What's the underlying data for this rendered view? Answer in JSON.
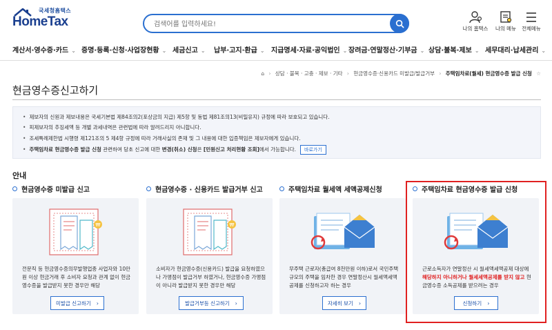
{
  "header": {
    "logo_small": "국세청홈택스",
    "logo_main": "HomeTax",
    "search_placeholder": "검색어를 입력하세요!",
    "icons": [
      {
        "label": "나의 홈택스",
        "icon": "person-icon"
      },
      {
        "label": "나의 메뉴",
        "icon": "my-menu-icon"
      },
      {
        "label": "전체메뉴",
        "icon": "hamburger-icon"
      }
    ]
  },
  "nav": [
    "계산서·영수증·카드",
    "증명·등록·신청·사업장현황",
    "세금신고",
    "납부·고지·환급",
    "지급명세·자료·공익법인",
    "장려금·연말정산·기부금",
    "상담·불복·제보",
    "세무대리·납세관리"
  ],
  "breadcrumb": {
    "items": [
      "상담 · 불복 · 고충 · 제보 · 기타",
      "현금영수증·신용카드 미발급/발급거부"
    ],
    "current": "주택임차료(월세) 현금영수증 발급 신청"
  },
  "page_title": "현금영수증신고하기",
  "notice": {
    "lines": [
      "제보자의 신원과 제보내용은 국세기본법 제84조의2(포상금의 지급) 제5항 및 동법 제81조의13(비밀유지) 규정에 따라 보호되고 있습니다.",
      "피제보자의 추징세액 등 개별 과세내역은 관련법에 따라 알려드리지 아니합니다.",
      "조세특례제한법 시행령 제121조의 5 제4항 규정에 따라 거래사실의 존재 및 그 내용에 대한 입증책임은 제보자에게 있습니다."
    ],
    "last_line": {
      "bold1": "주택임차료 현금영수증 발급 신청",
      "text1": " 관련하여 당초 신고에 대한 ",
      "bold2": "변경(취소) 신청",
      "text2": "은 ",
      "bold3": "[민원신고 처리현황 조회]",
      "text3": "에서 가능합니다.",
      "button": "바로가기"
    }
  },
  "guide_title": "안내",
  "cards": [
    {
      "title": "현금영수증 미발급 신고",
      "desc": "전문직 등 현금영수증의무발행업종 사업자와 10만원 이상 현금거래 후 소비자 요청과 관계 없이 현금영수증을 발급받지 못한 경우만 해당",
      "button": "미발급 신고하기"
    },
    {
      "title": "현금영수증 · 신용카드 발급거부 신고",
      "desc": "소비자가 현금영수증(신용카드) 발급을 요청하였으나 가맹점이 발급거부 하였거나, 현금영수증 가맹점이 아니라 발급받지 못한 경우만 해당",
      "button": "발급거부등 신고하기"
    },
    {
      "title": "주택임차료 월세액 세액공제신청",
      "desc": "무주택 근로자(총급여 8천만원 이하)로서 국민주택 규모의 주택을 임차한 경우 연말정산시 월세액세액공제를 신청하고자 하는 경우",
      "button": "자세히 보기"
    },
    {
      "title": "주택임차료 현금영수증 발급 신청",
      "desc_pre": "근로소득자가 연말정산 시 월세액세액공제 대상에 ",
      "desc_red": "해당하지 아니하거나 월세세액공제를 받지 않고",
      "desc_post": " 현금영수증 소득공제를 받으려는 경우",
      "button": "신청하기"
    }
  ],
  "colors": {
    "accent": "#2a6fd0",
    "highlight": "#e02020",
    "card_bg": "#f1f3f7"
  }
}
